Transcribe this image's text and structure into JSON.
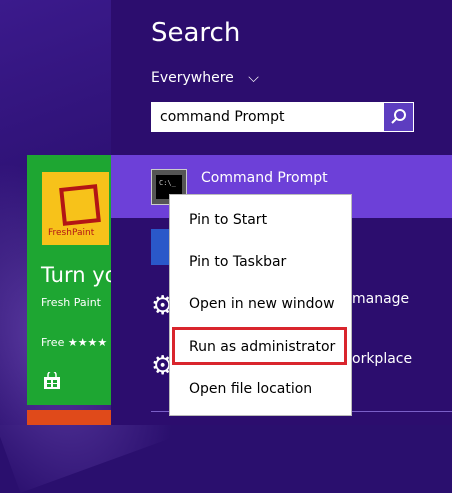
{
  "start_tiles": {
    "fresh_paint": {
      "logo_text": "FreshPaint",
      "headline": "Turn yo",
      "app_name": "Fresh Paint",
      "price_rating": "Free ★★★★"
    }
  },
  "search_pane": {
    "title": "Search",
    "scope": "Everywhere",
    "query": "command Prompt",
    "results": [
      {
        "label": "Command Prompt"
      },
      {
        "label": "manage"
      },
      {
        "label": "orkplace"
      }
    ]
  },
  "context_menu": {
    "items": [
      {
        "label": "Pin to Start"
      },
      {
        "label": "Pin to Taskbar"
      },
      {
        "label": "Open in new window"
      },
      {
        "label": "Run as administrator"
      },
      {
        "label": "Open file location"
      }
    ],
    "highlighted_item": "Run as administrator",
    "highlight_color": "#d9252d"
  },
  "colors": {
    "background": "#2a0f6e",
    "selected_result": "#6d40d8",
    "search_button": "#5d3dc0",
    "tile_green": "#1ea632"
  },
  "icons": [
    "search-icon",
    "chevron-down-icon",
    "cmd-icon",
    "gear-icon",
    "store-icon"
  ]
}
